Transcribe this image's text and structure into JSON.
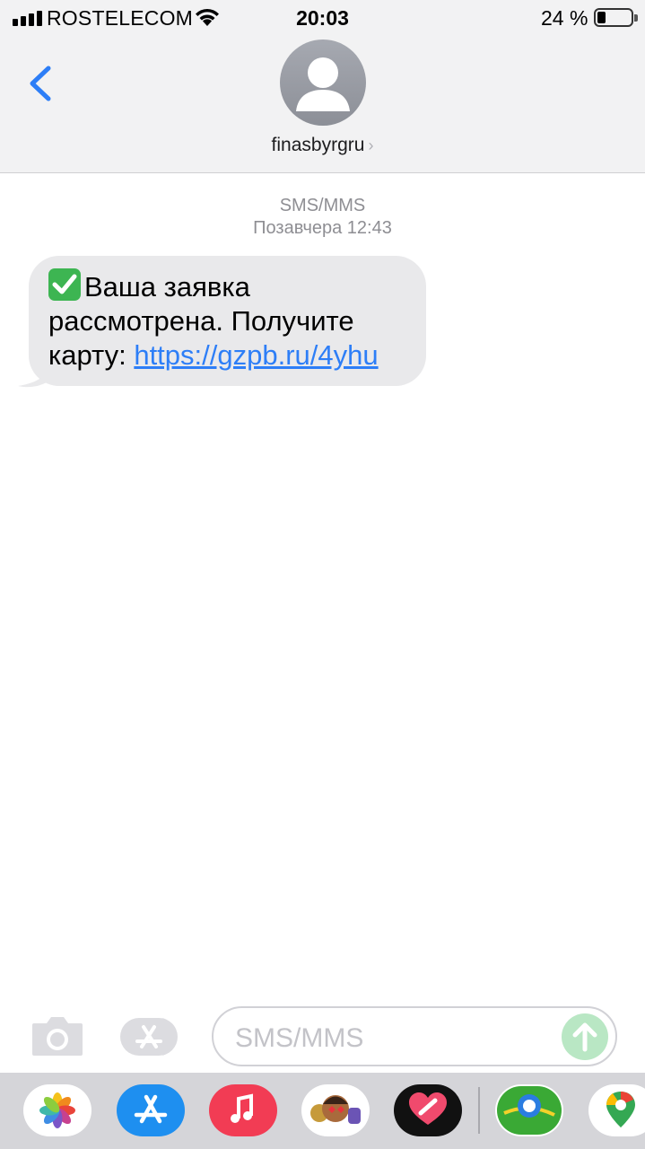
{
  "status_bar": {
    "carrier": "ROSTELECOM",
    "time": "20:03",
    "battery": "24 %"
  },
  "header": {
    "contact_name": "finasbyrgru",
    "chevron": "›"
  },
  "conversation": {
    "message_type": "SMS/MMS",
    "timestamp": "Позавчера 12:43",
    "messages": [
      {
        "direction": "incoming",
        "line1": "Ваша заявка",
        "line2": "рассмотрена. Получите",
        "line3_text": "карту: ",
        "link": "https://gzpb.ru/4yhu"
      }
    ]
  },
  "composer": {
    "placeholder": "SMS/MMS"
  },
  "app_dock": {
    "apps": [
      "photos-icon",
      "app-store-icon",
      "music-icon",
      "memoji-icon",
      "heart-app-icon",
      "maps-app-icon",
      "google-maps-icon"
    ]
  },
  "colors": {
    "bubble": "#e9e9eb",
    "link": "#2d7ef7",
    "back": "#2d7ef7",
    "send_disabled": "#b9e7c4",
    "header_bg": "#f2f2f3"
  }
}
